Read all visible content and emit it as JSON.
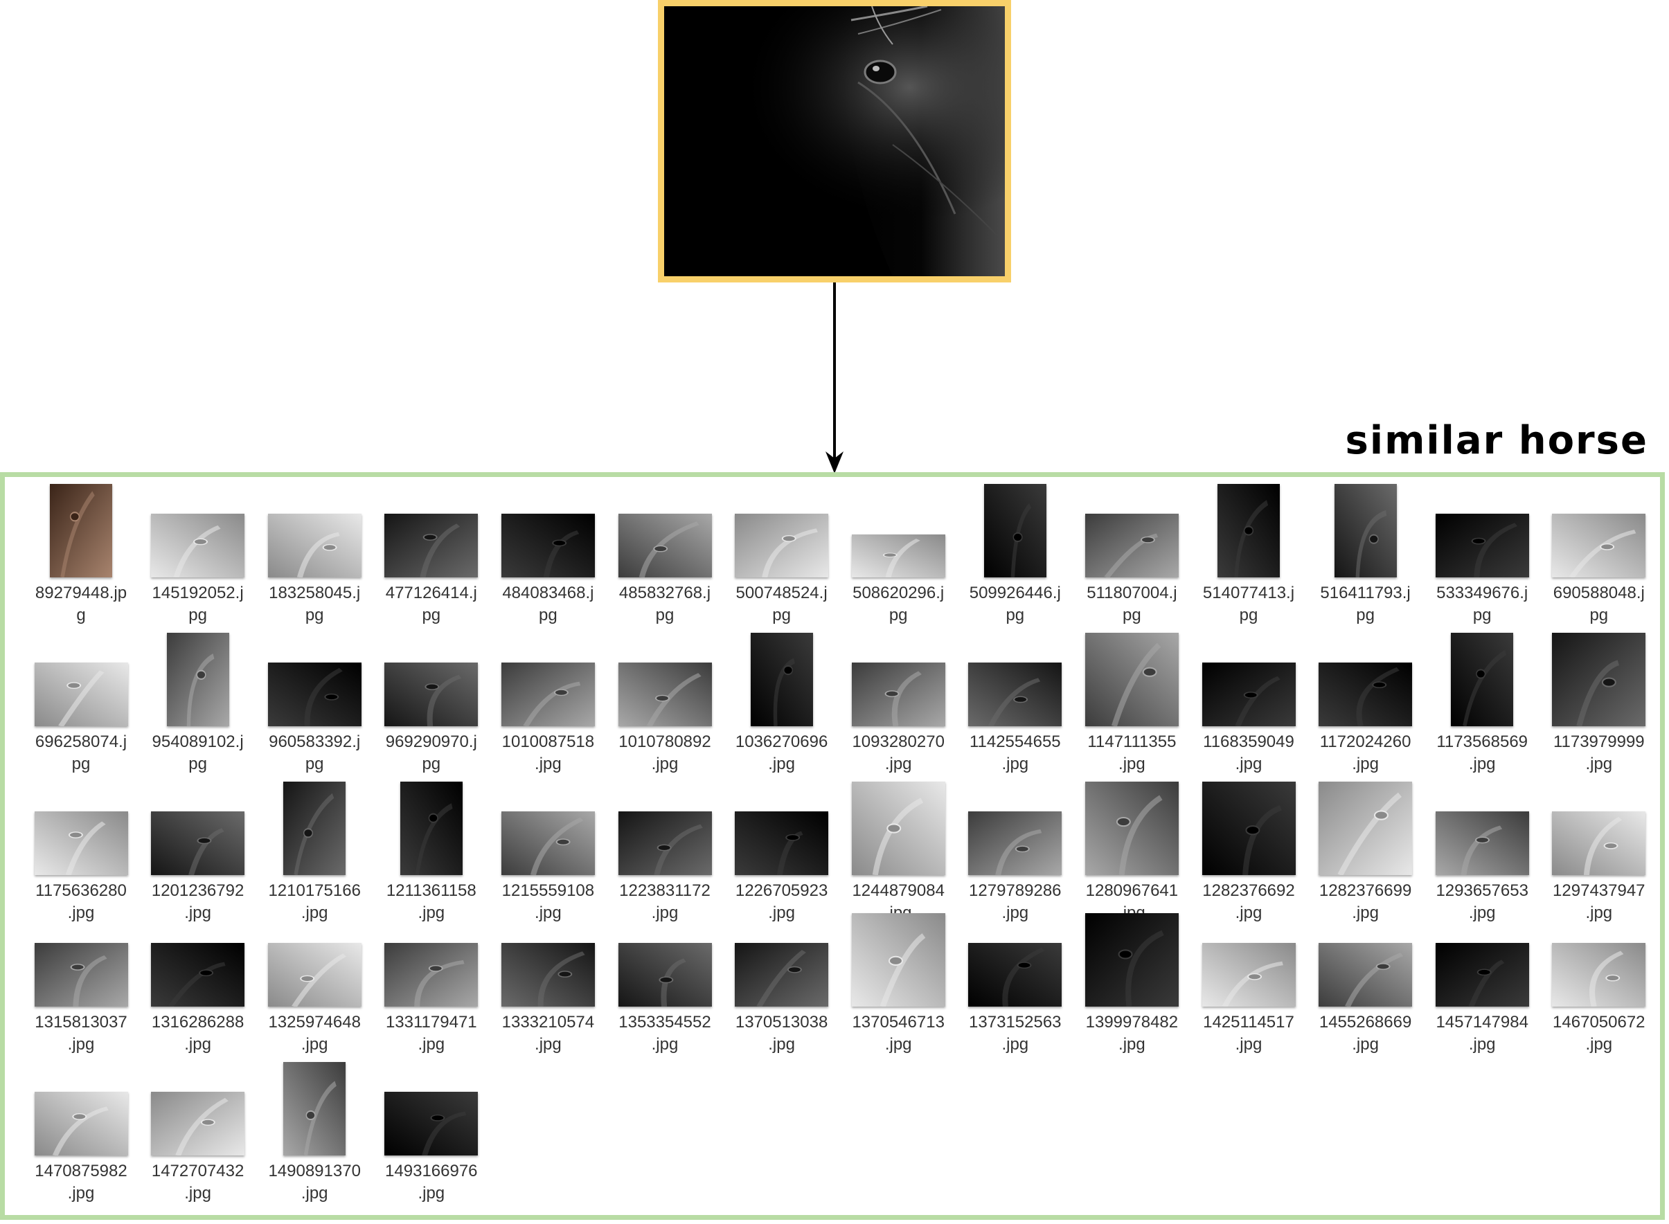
{
  "caption": "similar horse",
  "colors": {
    "query_border": "#f8d06a",
    "panel_border": "#b8dca4",
    "arrow": "#000000"
  },
  "query": {
    "icon": "horse-eye-closeup",
    "tone": "dark"
  },
  "results": [
    {
      "name1": "89279448.jp",
      "name2": "g",
      "shape": "portrait",
      "tone": "sepia"
    },
    {
      "name1": "145192052.j",
      "name2": "pg",
      "shape": "landscape",
      "tone": "light"
    },
    {
      "name1": "183258045.j",
      "name2": "pg",
      "shape": "landscape",
      "tone": "light"
    },
    {
      "name1": "477126414.j",
      "name2": "pg",
      "shape": "landscape",
      "tone": "dark"
    },
    {
      "name1": "484083468.j",
      "name2": "pg",
      "shape": "landscape",
      "tone": "black"
    },
    {
      "name1": "485832768.j",
      "name2": "pg",
      "shape": "landscape",
      "tone": "mid"
    },
    {
      "name1": "500748524.j",
      "name2": "pg",
      "shape": "landscape",
      "tone": "light"
    },
    {
      "name1": "508620296.j",
      "name2": "pg",
      "shape": "wide",
      "tone": "light"
    },
    {
      "name1": "509926446.j",
      "name2": "pg",
      "shape": "portrait",
      "tone": "black"
    },
    {
      "name1": "511807004.j",
      "name2": "pg",
      "shape": "landscape",
      "tone": "mid"
    },
    {
      "name1": "514077413.j",
      "name2": "pg",
      "shape": "portrait",
      "tone": "black"
    },
    {
      "name1": "516411793.j",
      "name2": "pg",
      "shape": "portrait",
      "tone": "dark"
    },
    {
      "name1": "533349676.j",
      "name2": "pg",
      "shape": "landscape",
      "tone": "black"
    },
    {
      "name1": "690588048.j",
      "name2": "pg",
      "shape": "landscape",
      "tone": "light"
    },
    {
      "name1": "696258074.j",
      "name2": "pg",
      "shape": "landscape",
      "tone": "light"
    },
    {
      "name1": "954089102.j",
      "name2": "pg",
      "shape": "portrait",
      "tone": "mid"
    },
    {
      "name1": "960583392.j",
      "name2": "pg",
      "shape": "landscape",
      "tone": "black"
    },
    {
      "name1": "969290970.j",
      "name2": "pg",
      "shape": "landscape",
      "tone": "dark"
    },
    {
      "name1": "1010087518",
      "name2": ".jpg",
      "shape": "landscape",
      "tone": "mid"
    },
    {
      "name1": "1010780892",
      "name2": ".jpg",
      "shape": "landscape",
      "tone": "mid"
    },
    {
      "name1": "1036270696",
      "name2": ".jpg",
      "shape": "portrait",
      "tone": "black"
    },
    {
      "name1": "1093280270",
      "name2": ".jpg",
      "shape": "landscape",
      "tone": "mid"
    },
    {
      "name1": "1142554655",
      "name2": ".jpg",
      "shape": "landscape",
      "tone": "dark"
    },
    {
      "name1": "1147111355",
      "name2": ".jpg",
      "shape": "landscape-tall",
      "tone": "mid"
    },
    {
      "name1": "1168359049",
      "name2": ".jpg",
      "shape": "landscape",
      "tone": "black"
    },
    {
      "name1": "1172024260",
      "name2": ".jpg",
      "shape": "landscape",
      "tone": "black"
    },
    {
      "name1": "1173568569",
      "name2": ".jpg",
      "shape": "portrait",
      "tone": "black"
    },
    {
      "name1": "1173979999",
      "name2": ".jpg",
      "shape": "landscape-tall",
      "tone": "dark"
    },
    {
      "name1": "1175636280",
      "name2": ".jpg",
      "shape": "landscape",
      "tone": "light"
    },
    {
      "name1": "1201236792",
      "name2": ".jpg",
      "shape": "landscape",
      "tone": "dark"
    },
    {
      "name1": "1210175166",
      "name2": ".jpg",
      "shape": "portrait",
      "tone": "dark"
    },
    {
      "name1": "1211361158",
      "name2": ".jpg",
      "shape": "portrait",
      "tone": "black"
    },
    {
      "name1": "1215559108",
      "name2": ".jpg",
      "shape": "landscape",
      "tone": "mid"
    },
    {
      "name1": "1223831172",
      "name2": ".jpg",
      "shape": "landscape",
      "tone": "dark"
    },
    {
      "name1": "1226705923",
      "name2": ".jpg",
      "shape": "landscape",
      "tone": "black"
    },
    {
      "name1": "1244879084",
      "name2": ".jpg",
      "shape": "landscape-tall",
      "tone": "light"
    },
    {
      "name1": "1279789286",
      "name2": ".jpg",
      "shape": "landscape",
      "tone": "mid"
    },
    {
      "name1": "1280967641",
      "name2": ".jpg",
      "shape": "landscape-tall",
      "tone": "mid"
    },
    {
      "name1": "1282376692",
      "name2": ".jpg",
      "shape": "landscape-tall",
      "tone": "black"
    },
    {
      "name1": "1282376699",
      "name2": ".jpg",
      "shape": "landscape-tall",
      "tone": "light"
    },
    {
      "name1": "1293657653",
      "name2": ".jpg",
      "shape": "landscape",
      "tone": "mid"
    },
    {
      "name1": "1297437947",
      "name2": ".jpg",
      "shape": "landscape",
      "tone": "light"
    },
    {
      "name1": "1315813037",
      "name2": ".jpg",
      "shape": "landscape",
      "tone": "mid"
    },
    {
      "name1": "1316286288",
      "name2": ".jpg",
      "shape": "landscape",
      "tone": "black"
    },
    {
      "name1": "1325974648",
      "name2": ".jpg",
      "shape": "landscape",
      "tone": "light"
    },
    {
      "name1": "1331179471",
      "name2": ".jpg",
      "shape": "landscape",
      "tone": "mid"
    },
    {
      "name1": "1333210574",
      "name2": ".jpg",
      "shape": "landscape",
      "tone": "dark"
    },
    {
      "name1": "1353354552",
      "name2": ".jpg",
      "shape": "landscape",
      "tone": "dark"
    },
    {
      "name1": "1370513038",
      "name2": ".jpg",
      "shape": "landscape",
      "tone": "dark"
    },
    {
      "name1": "1370546713",
      "name2": ".jpg",
      "shape": "landscape-tall",
      "tone": "light"
    },
    {
      "name1": "1373152563",
      "name2": ".jpg",
      "shape": "landscape",
      "tone": "black"
    },
    {
      "name1": "1399978482",
      "name2": ".jpg",
      "shape": "landscape-tall",
      "tone": "black"
    },
    {
      "name1": "1425114517",
      "name2": ".jpg",
      "shape": "landscape",
      "tone": "light"
    },
    {
      "name1": "1455268669",
      "name2": ".jpg",
      "shape": "landscape",
      "tone": "mid"
    },
    {
      "name1": "1457147984",
      "name2": ".jpg",
      "shape": "landscape",
      "tone": "black"
    },
    {
      "name1": "1467050672",
      "name2": ".jpg",
      "shape": "landscape",
      "tone": "light"
    },
    {
      "name1": "1470875982",
      "name2": ".jpg",
      "shape": "landscape",
      "tone": "light"
    },
    {
      "name1": "1472707432",
      "name2": ".jpg",
      "shape": "landscape",
      "tone": "light"
    },
    {
      "name1": "1490891370",
      "name2": ".jpg",
      "shape": "portrait",
      "tone": "mid"
    },
    {
      "name1": "1493166976",
      "name2": ".jpg",
      "shape": "landscape",
      "tone": "black"
    }
  ]
}
